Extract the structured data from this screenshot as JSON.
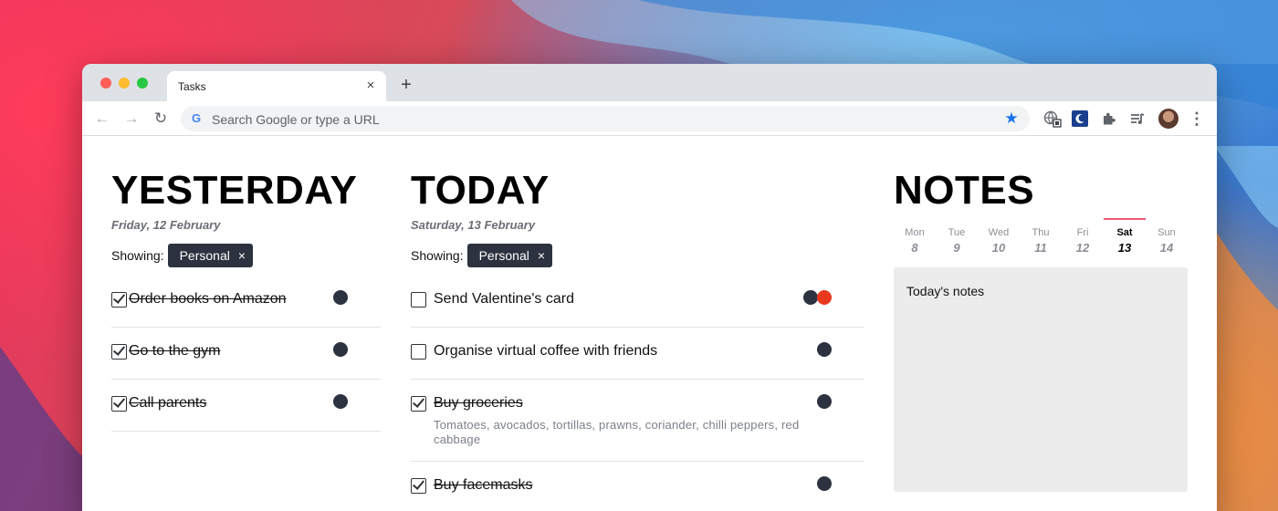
{
  "browser": {
    "tab_title": "Tasks",
    "tab_close": "×",
    "new_tab": "+",
    "back_icon": "←",
    "forward_icon": "→",
    "reload_icon": "↻",
    "search_placeholder": "Search Google or type a URL",
    "google_icon": "G",
    "star_icon": "★",
    "menu_icon": "⋮"
  },
  "columns": {
    "yesterday": {
      "heading": "YESTERDAY",
      "date": "Friday, 12 February",
      "filter_label": "Showing:",
      "filter_chip": "Personal",
      "chip_close": "×",
      "tasks": [
        {
          "text": "Order books on Amazon",
          "done": true,
          "dots": [
            "#2d3240"
          ]
        },
        {
          "text": "Go to the gym",
          "done": true,
          "dots": [
            "#2d3240"
          ]
        },
        {
          "text": "Call parents",
          "done": true,
          "dots": [
            "#2d3240"
          ]
        }
      ]
    },
    "today": {
      "heading": "TODAY",
      "date": "Saturday, 13 February",
      "filter_label": "Showing:",
      "filter_chip": "Personal",
      "chip_close": "×",
      "tasks": [
        {
          "text": "Send Valentine's card",
          "done": false,
          "dots": [
            "#2d3240",
            "#e8391f"
          ]
        },
        {
          "text": "Organise virtual coffee with friends",
          "done": false,
          "dots": [
            "#2d3240"
          ]
        },
        {
          "text": "Buy groceries",
          "done": true,
          "note": "Tomatoes, avocados, tortillas, prawns, coriander, chilli peppers, red cabbage",
          "dots": [
            "#2d3240"
          ]
        },
        {
          "text": "Buy facemasks",
          "done": true,
          "dots": [
            "#2d3240"
          ]
        }
      ]
    },
    "notes": {
      "heading": "NOTES",
      "days": [
        {
          "name": "Mon",
          "num": "8",
          "active": false
        },
        {
          "name": "Tue",
          "num": "9",
          "active": false
        },
        {
          "name": "Wed",
          "num": "10",
          "active": false
        },
        {
          "name": "Thu",
          "num": "11",
          "active": false
        },
        {
          "name": "Fri",
          "num": "12",
          "active": false
        },
        {
          "name": "Sat",
          "num": "13",
          "active": true
        },
        {
          "name": "Sun",
          "num": "14",
          "active": false
        }
      ],
      "notes_title": "Today's notes"
    }
  },
  "colors": {
    "chip_bg": "#2d3240",
    "accent_pink": "#ee5a7a",
    "dot_red": "#e8391f",
    "star_blue": "#1a73e8"
  }
}
